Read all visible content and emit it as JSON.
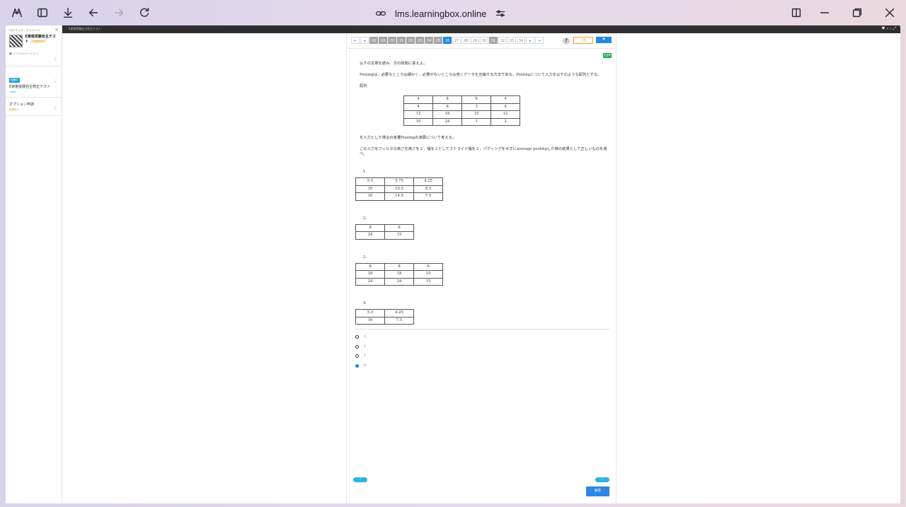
{
  "browser": {
    "url": "lms.learningbox.online"
  },
  "sidebar": {
    "header_small": "ロジブック・チャレンジ",
    "course_title": "E資格受験自主テスト",
    "course_title_suffix": "（rabbit）",
    "meta": "■ インフォメーション",
    "items": [
      {
        "badge": "受講中",
        "title": "E資格受験自主修正テスト",
        "tag": "rabbit"
      },
      {
        "title": "オプション申請",
        "tag": "申請終了"
      }
    ],
    "close": "×"
  },
  "content_bar": {
    "breadcrumb": "E資格受験自主修正テスト"
  },
  "question_nav": {
    "first": "⇤",
    "prev": "◂",
    "numbers": [
      {
        "n": "18",
        "state": "gray"
      },
      {
        "n": "19",
        "state": "gray"
      },
      {
        "n": "20",
        "state": "gray"
      },
      {
        "n": "21",
        "state": "gray"
      },
      {
        "n": "22",
        "state": "gray"
      },
      {
        "n": "23",
        "state": "gray"
      },
      {
        "n": "24",
        "state": "gray"
      },
      {
        "n": "25",
        "state": "gray"
      },
      {
        "n": "26",
        "state": "cur"
      },
      {
        "n": "27",
        "state": ""
      },
      {
        "n": "28",
        "state": ""
      },
      {
        "n": "29",
        "state": ""
      },
      {
        "n": "30",
        "state": ""
      },
      {
        "n": "31",
        "state": "gray"
      },
      {
        "n": "32",
        "state": ""
      },
      {
        "n": "33",
        "state": ""
      },
      {
        "n": "34",
        "state": ""
      }
    ],
    "next": "▸",
    "last": "⇥",
    "help": "?",
    "orange_button": "一覧",
    "flag_button": "⚑"
  },
  "badge": "正答率",
  "question": {
    "intro": "以下の文章を読み、次の問題に答えよ。",
    "para1": "Poolingは、必要なところは細かく、必要がないところは荒くデータを圧縮する方法である。Poolingについて入力を以下のような配列とする。",
    "label_array": "配列",
    "input_table": [
      [
        "4",
        "8",
        "6",
        "4"
      ],
      [
        "4",
        "6",
        "3",
        "4"
      ],
      [
        "12",
        "18",
        "15",
        "12"
      ],
      [
        "10",
        "24",
        "1",
        "2"
      ]
    ],
    "para2": "を入力とした場合の各種Poolingの演算について考える。",
    "para3": "この入力をフィルタの高さを高さを２，幅を２としてストライド幅を２，パディングをせずにaverage poolingした時の結果として正しいものを選べ。",
    "options": [
      {
        "label": "1.",
        "table": [
          [
            "5.5",
            "5.75",
            "4.25"
          ],
          [
            "10",
            "10.5",
            "8.5"
          ],
          [
            "16",
            "14.5",
            "7.5"
          ]
        ]
      },
      {
        "label": "2.",
        "table": [
          [
            "8",
            "6"
          ],
          [
            "24",
            "15"
          ]
        ]
      },
      {
        "label": "3.",
        "table": [
          [
            "8",
            "8",
            "6"
          ],
          [
            "18",
            "18",
            "15"
          ],
          [
            "24",
            "24",
            "15"
          ]
        ]
      },
      {
        "label": "4.",
        "table": [
          [
            "5.5",
            "4.25"
          ],
          [
            "16",
            "7.5"
          ]
        ]
      }
    ],
    "choices": [
      "1",
      "2",
      "3",
      "4"
    ],
    "selected": "4"
  },
  "footer": {
    "prev": "‹",
    "next": "›",
    "submit": "解答"
  }
}
